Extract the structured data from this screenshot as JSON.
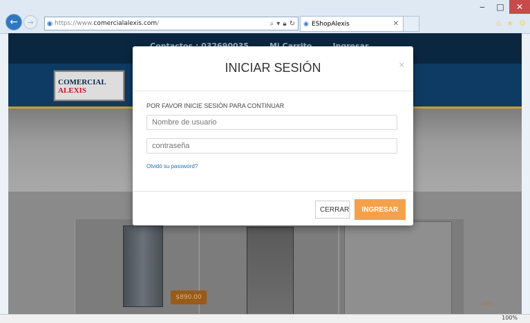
{
  "browser": {
    "url_prefix": "https://www.",
    "url_host": "comercialalexis.com",
    "url_suffix": "/",
    "tab_title": "EShopAlexis",
    "zoom": "100%"
  },
  "modal": {
    "title": "INICIAR SESIÓN",
    "close": "×",
    "prompt": "POR FAVOR INICIE SESIÓN PARA CONTINUAR",
    "username_placeholder": "Nombre de usuario",
    "password_placeholder": "contraseña",
    "forgot": "Olvidó su password?",
    "cancel": "CERRAR",
    "submit": "INGRESAR"
  },
  "site": {
    "links": [
      "Contactos : 032690035",
      "Mi Carrito",
      "Ingresar"
    ],
    "logo_text_a": "OMERCIAL ",
    "logo_text_b": "ALEXIS",
    "logo_letter": "C",
    "price": "$890.00",
    "linea": "LINEA"
  },
  "icons": {
    "back": "back-arrow-icon",
    "forward": "forward-arrow-icon",
    "search": "search-icon",
    "lock": "lock-icon",
    "refresh": "refresh-icon",
    "home": "home-icon",
    "favorites": "star-icon",
    "settings": "gear-icon"
  }
}
